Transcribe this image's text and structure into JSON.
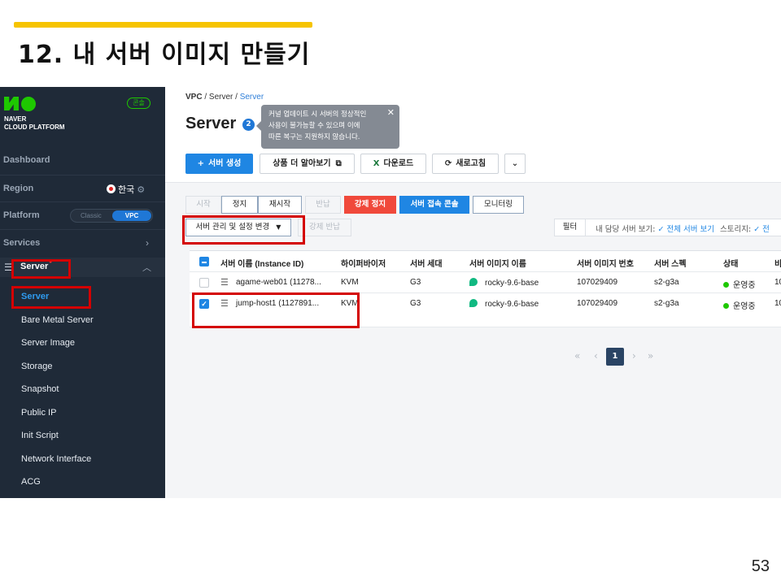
{
  "slide": {
    "title": "12. 내 서버 이미지 만들기",
    "page_number": "53",
    "bar_color": "#f6c400"
  },
  "sidebar": {
    "logo_text_line1": "NAVER",
    "logo_text_line2": "CLOUD PLATFORM",
    "console_badge": "콘솔",
    "dashboard": "Dashboard",
    "region_label": "Region",
    "region_value": "한국",
    "platform_label": "Platform",
    "platform_classic": "Classic",
    "platform_vpc": "VPC",
    "services_label": "Services",
    "server_label": "Server",
    "sub_items": [
      {
        "label": "Server",
        "active": true
      },
      {
        "label": "Bare Metal Server"
      },
      {
        "label": "Server Image"
      },
      {
        "label": "Storage"
      },
      {
        "label": "Snapshot"
      },
      {
        "label": "Public IP"
      },
      {
        "label": "Init Script"
      },
      {
        "label": "Network Interface"
      },
      {
        "label": "ACG"
      }
    ]
  },
  "header": {
    "breadcrumb_root": "VPC",
    "breadcrumb_mid": "Server",
    "breadcrumb_current": "Server",
    "title": "Server",
    "help_count": "2",
    "tooltip_line1": "커널 업데이트 시 서버의 정상적인",
    "tooltip_line2": "사용이 불가능할 수 있으며 이에",
    "tooltip_line3": "따른 복구는 지원하지 않습니다.",
    "tooltip_close": "✕"
  },
  "toolbar": {
    "create": "서버 생성",
    "learn_more": "상품 더 알아보기",
    "download": "다운로드",
    "refresh": "새로고침"
  },
  "actions": {
    "start": "시작",
    "stop": "정지",
    "restart": "재시작",
    "return": "반납",
    "force_stop": "강제 정지",
    "console": "서버 접속 콘솔",
    "monitoring": "모니터링",
    "manage": "서버 관리 및 설정 변경",
    "force_return": "강제 반납"
  },
  "filter": {
    "button": "필터",
    "my_servers": "내 담당 서버 보기:",
    "all_servers": "전체 서버 보기",
    "storage": "스토리지:",
    "storage_value": "전"
  },
  "table": {
    "headers": [
      "서버 이름 (Instance ID)",
      "하이퍼바이저",
      "서버 세대",
      "서버 이미지 이름",
      "서버 이미지 번호",
      "서버 스펙",
      "상태",
      "비"
    ],
    "rows": [
      {
        "name": "agame-web01 (11278...",
        "hypervisor": "KVM",
        "generation": "G3",
        "image_name": "rocky-9.6-base",
        "image_no": "107029409",
        "spec": "s2-g3a",
        "status": "운영중",
        "extra": "10",
        "checked": false
      },
      {
        "name": "jump-host1 (1127891...",
        "hypervisor": "KVM",
        "generation": "G3",
        "image_name": "rocky-9.6-base",
        "image_no": "107029409",
        "spec": "s2-g3a",
        "status": "운영중",
        "extra": "10",
        "checked": true
      }
    ]
  },
  "pagination": {
    "first": "«",
    "prev": "‹",
    "current": "1",
    "next": "›",
    "last": "»"
  },
  "colors": {
    "sidebar_bg": "#1f2a38",
    "brand_green": "#1ec800",
    "primary_blue": "#1f86e3",
    "danger_red": "#f0493b",
    "highlight_red": "#d40000"
  }
}
